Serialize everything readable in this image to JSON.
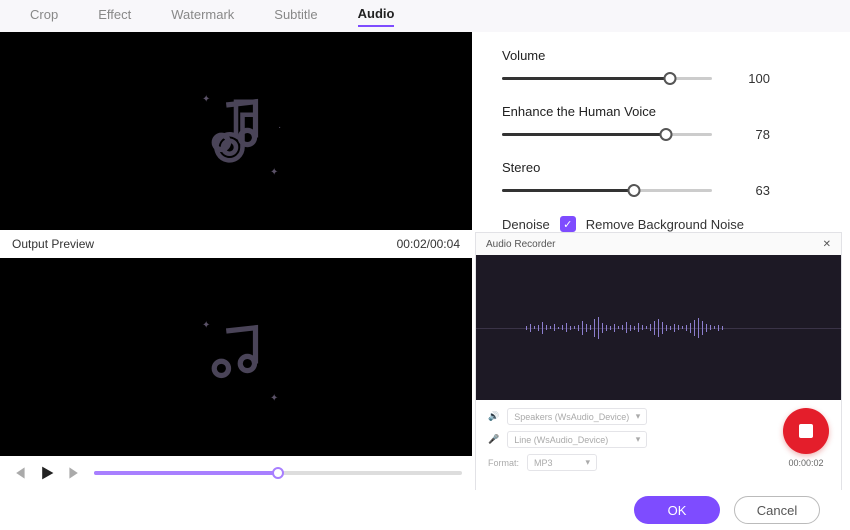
{
  "tabs": [
    "Crop",
    "Effect",
    "Watermark",
    "Subtitle",
    "Audio"
  ],
  "active_tab": 4,
  "preview": {
    "label": "Output Preview",
    "time": "00:02/00:04",
    "timeline_pct": 50
  },
  "sliders": {
    "volume": {
      "label": "Volume",
      "value": 100,
      "pct": 80
    },
    "voice": {
      "label": "Enhance the Human Voice",
      "value": 78,
      "pct": 78
    },
    "stereo": {
      "label": "Stereo",
      "value": 63,
      "pct": 63
    }
  },
  "denoise": {
    "prefix": "Denoise",
    "label": "Remove Background Noise",
    "checked": true
  },
  "recorder": {
    "title": "Audio Recorder",
    "speaker": "Speakers (WsAudio_Device)",
    "mic": "Line (WsAudio_Device)",
    "format_label": "Format:",
    "format": "MP3",
    "time": "00:00:02"
  },
  "footer": {
    "ok": "OK",
    "cancel": "Cancel"
  }
}
